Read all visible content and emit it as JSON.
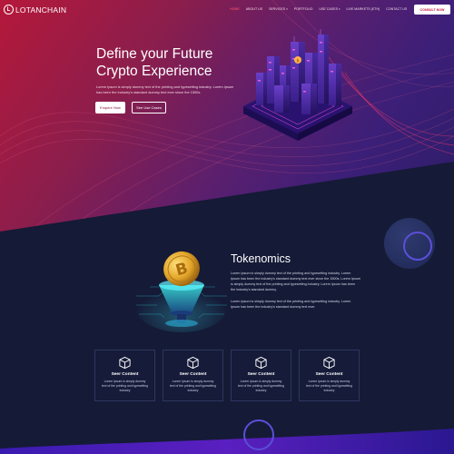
{
  "brand": {
    "name": "LOTANCHAIN",
    "mark": "L"
  },
  "nav": {
    "items": [
      {
        "label": "HOME",
        "active": true,
        "caret": false
      },
      {
        "label": "ABOUT US",
        "active": false,
        "caret": false
      },
      {
        "label": "SERVICES",
        "active": false,
        "caret": true
      },
      {
        "label": "PORTFOLIO",
        "active": false,
        "caret": false
      },
      {
        "label": "USE CASES",
        "active": false,
        "caret": true
      },
      {
        "label": "LIVE MARKETS (ETH)",
        "active": false,
        "caret": false
      },
      {
        "label": "CONTACT US",
        "active": false,
        "caret": false
      }
    ],
    "cta_label": "CONSULT NOW"
  },
  "hero": {
    "title": "Define your Future Crypto Experience",
    "description": "Lorem Ipsum is simply dummy text of the printing and typesetting industry. Lorem Ipsum has been the industry's standard dummy text ever since the 1500s.",
    "primary_button": "Enquire Now",
    "secondary_button": "See Use Cases"
  },
  "tokenomics": {
    "title": "Tokenomics",
    "paragraph1": "Lorem Ipsum is simply dummy text of the printing and typesetting industry. Lorem Ipsum has been the industry's standard dummy text ever since the 1500s. Lorem Ipsum is simply dummy text of the printing and typesetting industry. Lorem Ipsum has been the industry's standard dummy.",
    "paragraph2": "Lorem Ipsum is simply dummy text of the printing and typesetting industry. Lorem Ipsum has been the industry's standard dummy text ever."
  },
  "cards": [
    {
      "title": "Seer Content",
      "text": "Lorem Ipsum is simply dummy text of the printing and typesetting industry"
    },
    {
      "title": "Seer Content",
      "text": "Lorem Ipsum is simply dummy text of the printing and typesetting industry"
    },
    {
      "title": "Seer Content",
      "text": "Lorem Ipsum is simply dummy text of the printing and typesetting industry"
    },
    {
      "title": "Seer Content",
      "text": "Lorem Ipsum is simply dummy text of the printing and typesetting industry"
    }
  ],
  "icons": {
    "card_icon": "cube-icon",
    "coin": "bitcoin-coin-icon"
  },
  "colors": {
    "accent": "#c4123e",
    "nav_active": "#ff5a6e",
    "ring": "#5b4fd8",
    "dark_bg": "#151a36"
  }
}
